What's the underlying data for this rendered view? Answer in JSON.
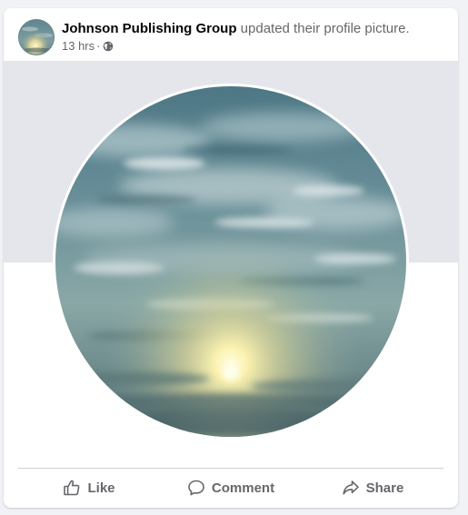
{
  "post": {
    "author": "Johnson Publishing Group",
    "action": "updated their profile picture.",
    "time": "13 hrs",
    "separator": "·",
    "privacy_icon": "globe-icon"
  },
  "actions": {
    "like": {
      "label": "Like",
      "icon": "thumbs-up-icon"
    },
    "comment": {
      "label": "Comment",
      "icon": "comment-bubble-icon"
    },
    "share": {
      "label": "Share",
      "icon": "share-arrow-icon"
    }
  },
  "colors": {
    "card_background": "#ffffff",
    "page_background": "#f0f2f5",
    "cover_band": "#e4e6eb",
    "primary_text": "#050505",
    "secondary_text": "#65676b",
    "divider": "#ced0d4"
  }
}
